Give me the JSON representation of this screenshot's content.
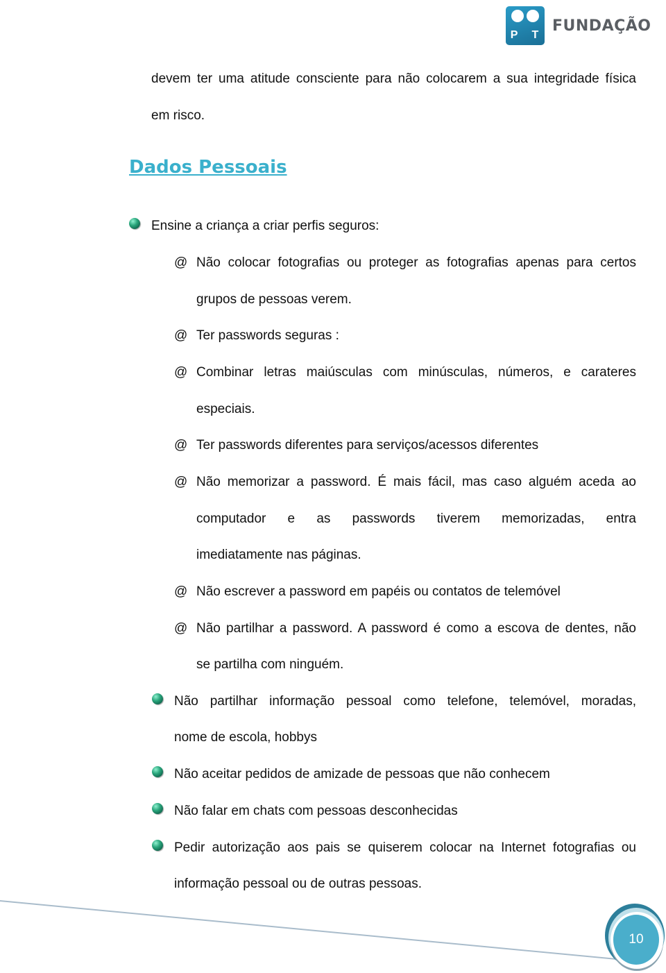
{
  "header": {
    "logo_letters": "P T",
    "logo_word": "FUNDAÇÃO"
  },
  "intro": {
    "line1": "devem ter uma atitude consciente para não colocarem a sua integridade física",
    "line2": "em risco."
  },
  "section": {
    "heading": "Dados Pessoais",
    "bullet_icon": "green-gem-bullet-icon",
    "sub_bullet_symbol": "@",
    "main_bullet": "Ensine a criança a criar perfis seguros:",
    "sub_items": [
      {
        "lines": [
          "Não colocar fotografias ou proteger as fotografias apenas para certos",
          "grupos de pessoas verem."
        ]
      },
      {
        "lines": [
          "Ter passwords seguras :"
        ]
      },
      {
        "lines": [
          "Combinar letras maiúsculas com minúsculas, números, e carateres",
          "especiais."
        ]
      },
      {
        "lines": [
          "Ter passwords diferentes para serviços/acessos diferentes"
        ]
      },
      {
        "lines": [
          "Não memorizar a password. É mais fácil, mas caso alguém aceda ao",
          "computador e as passwords tiverem memorizadas, entra",
          "imediatamente nas páginas."
        ]
      },
      {
        "lines": [
          "Não escrever a password em papéis ou contatos de telemóvel"
        ]
      },
      {
        "lines": [
          "Não partilhar a password. A password é como a escova de dentes, não",
          "se partilha com ninguém."
        ]
      }
    ],
    "bullets": [
      {
        "lines": [
          "Não partilhar informação pessoal como telefone, telemóvel, moradas,",
          "nome de escola, hobbys"
        ]
      },
      {
        "lines": [
          "Não aceitar pedidos de amizade de pessoas que não conhecem"
        ]
      },
      {
        "lines": [
          "Não falar em chats com pessoas desconhecidas"
        ]
      },
      {
        "lines": [
          "Pedir autorização aos pais se quiserem colocar na Internet fotografias ou",
          "informação pessoal ou de outras pessoas."
        ]
      }
    ]
  },
  "footer": {
    "page_number": "10"
  },
  "colors": {
    "heading": "#3ab0cc",
    "page_badge": "#4aaecb",
    "logo_blue": "#1f84b0"
  }
}
